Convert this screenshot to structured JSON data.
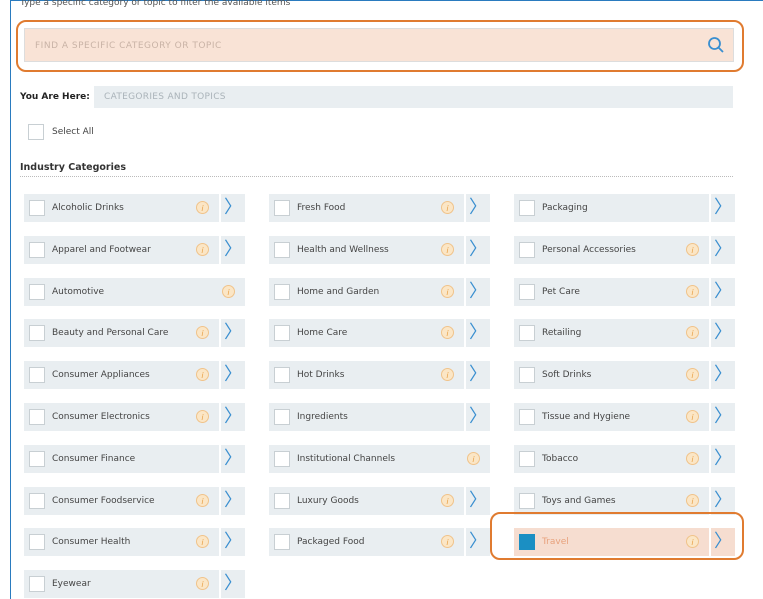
{
  "hint": "Type a specific category or topic to filter the available items",
  "search": {
    "placeholder": "FIND A SPECIFIC CATEGORY OR TOPIC",
    "value": ""
  },
  "breadcrumb": {
    "label": "You Are Here:",
    "value": "CATEGORIES AND TOPICS"
  },
  "select_all": "Select All",
  "section_title": "Industry Categories",
  "columns": [
    [
      {
        "label": "Alcoholic Drinks",
        "info": true
      },
      {
        "label": "Apparel and Footwear",
        "info": true
      },
      {
        "label": "Automotive",
        "info": true,
        "noarrow": true
      },
      {
        "label": "Beauty and Personal Care",
        "info": true
      },
      {
        "label": "Consumer Appliances",
        "info": true
      },
      {
        "label": "Consumer Electronics",
        "info": true
      },
      {
        "label": "Consumer Finance",
        "info": false
      },
      {
        "label": "Consumer Foodservice",
        "info": true
      },
      {
        "label": "Consumer Health",
        "info": true
      },
      {
        "label": "Eyewear",
        "info": true
      }
    ],
    [
      {
        "label": "Fresh Food",
        "info": true
      },
      {
        "label": "Health and Wellness",
        "info": true
      },
      {
        "label": "Home and Garden",
        "info": true
      },
      {
        "label": "Home Care",
        "info": true
      },
      {
        "label": "Hot Drinks",
        "info": true
      },
      {
        "label": "Ingredients",
        "info": false
      },
      {
        "label": "Institutional Channels",
        "info": true,
        "noarrow": true
      },
      {
        "label": "Luxury Goods",
        "info": true
      },
      {
        "label": "Packaged Food",
        "info": true
      }
    ],
    [
      {
        "label": "Packaging",
        "info": false
      },
      {
        "label": "Personal Accessories",
        "info": true
      },
      {
        "label": "Pet Care",
        "info": true
      },
      {
        "label": "Retailing",
        "info": true
      },
      {
        "label": "Soft Drinks",
        "info": true
      },
      {
        "label": "Tissue and Hygiene",
        "info": true
      },
      {
        "label": "Tobacco",
        "info": true
      },
      {
        "label": "Toys and Games",
        "info": true
      },
      {
        "label": "Travel",
        "info": true,
        "checked": true,
        "highlight": true
      }
    ]
  ],
  "colors": {
    "accent": "#1b8fc3",
    "highlight": "#e07b30",
    "arrow": "#3a8fd0"
  }
}
